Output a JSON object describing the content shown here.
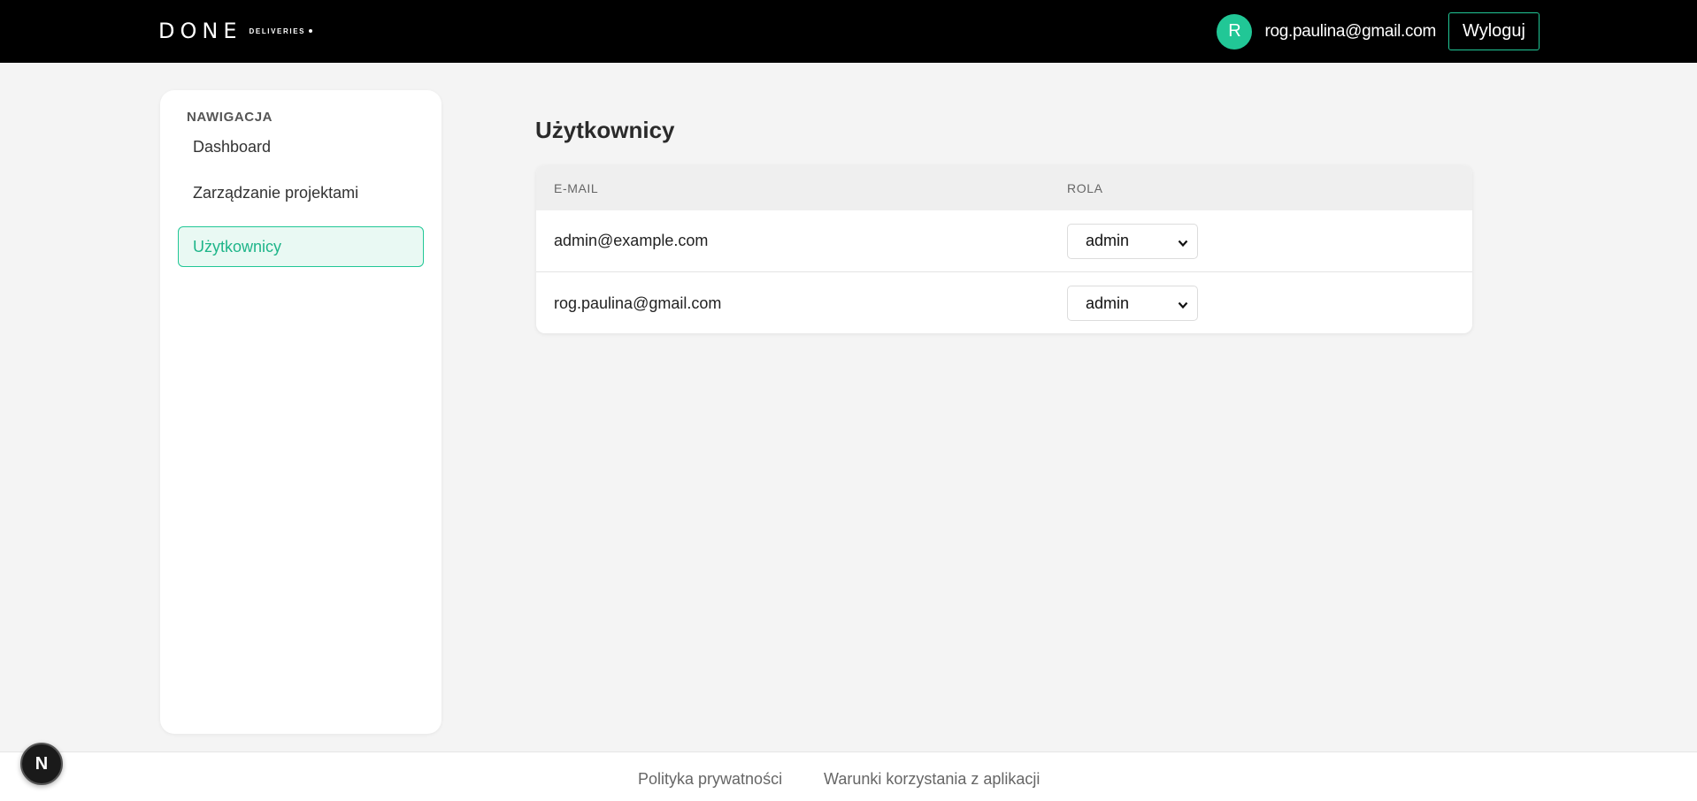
{
  "header": {
    "logo_main": "DONE",
    "logo_sub": "DELIVERIES",
    "avatar_initial": "R",
    "user_email": "rog.paulina@gmail.com",
    "logout_label": "Wyloguj"
  },
  "sidebar": {
    "title": "NAWIGACJA",
    "items": [
      {
        "label": "Dashboard",
        "active": false
      },
      {
        "label": "Zarządzanie projektami",
        "active": false
      },
      {
        "label": "Użytkownicy",
        "active": true
      }
    ]
  },
  "main": {
    "title": "Użytkownicy",
    "table": {
      "columns": [
        "E-MAIL",
        "ROLA"
      ],
      "rows": [
        {
          "email": "admin@example.com",
          "role": "admin"
        },
        {
          "email": "rog.paulina@gmail.com",
          "role": "admin"
        }
      ]
    }
  },
  "footer": {
    "links": [
      "Polityka prywatności",
      "Warunki korzystania z aplikacji"
    ]
  },
  "dev_badge": "N",
  "colors": {
    "accent": "#21c796",
    "topbar": "#000000",
    "background": "#f4f4f4"
  }
}
